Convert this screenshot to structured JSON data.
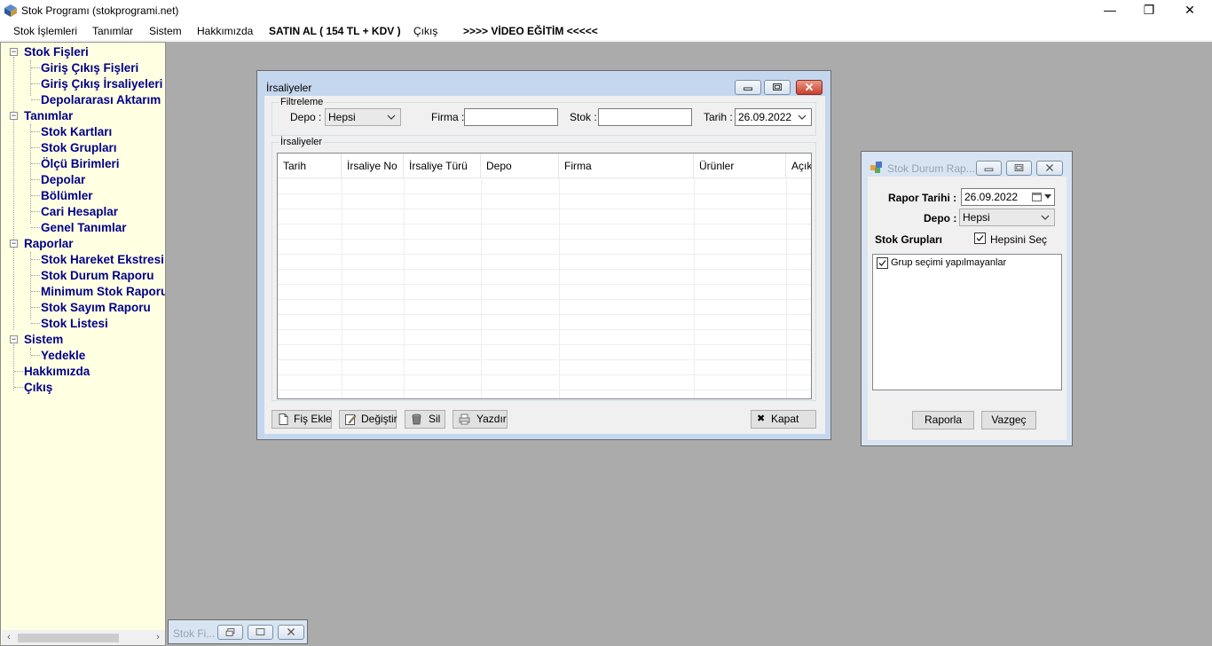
{
  "window": {
    "title": "Stok Programı (stokprogrami.net)",
    "minimize_glyph": "—",
    "restore_glyph": "❐",
    "close_glyph": "✕"
  },
  "menu": {
    "items": [
      {
        "label": "Stok İşlemleri"
      },
      {
        "label": "Tanımlar"
      },
      {
        "label": "Sistem"
      },
      {
        "label": "Hakkımızda"
      },
      {
        "label": "SATIN AL ( 154 TL + KDV )"
      },
      {
        "label": "Çıkış"
      },
      {
        "label": ">>>> VİDEO EĞİTİM <<<<<"
      }
    ]
  },
  "tree": {
    "nodes": [
      {
        "label": "Stok Fişleri",
        "level": 0,
        "expander": "−"
      },
      {
        "label": "Giriş Çıkış Fişleri",
        "level": 1
      },
      {
        "label": "Giriş Çıkış İrsaliyeleri",
        "level": 1
      },
      {
        "label": "Depolararası Aktarım",
        "level": 1
      },
      {
        "label": "Tanımlar",
        "level": 0,
        "expander": "−"
      },
      {
        "label": "Stok Kartları",
        "level": 1
      },
      {
        "label": "Stok Grupları",
        "level": 1
      },
      {
        "label": "Ölçü Birimleri",
        "level": 1
      },
      {
        "label": "Depolar",
        "level": 1
      },
      {
        "label": "Bölümler",
        "level": 1
      },
      {
        "label": "Cari Hesaplar",
        "level": 1
      },
      {
        "label": "Genel Tanımlar",
        "level": 1
      },
      {
        "label": "Raporlar",
        "level": 0,
        "expander": "−"
      },
      {
        "label": "Stok Hareket Ekstresi",
        "level": 1
      },
      {
        "label": "Stok Durum Raporu",
        "level": 1
      },
      {
        "label": "Minimum Stok Raporu",
        "level": 1
      },
      {
        "label": "Stok Sayım Raporu",
        "level": 1
      },
      {
        "label": "Stok Listesi",
        "level": 1
      },
      {
        "label": "Sistem",
        "level": 0,
        "expander": "−"
      },
      {
        "label": "Yedekle",
        "level": 1
      },
      {
        "label": "Hakkımızda",
        "level": 0
      },
      {
        "label": "Çıkış",
        "level": 0
      }
    ],
    "scroll_left": "‹",
    "scroll_right": "›"
  },
  "irsaliyeler": {
    "title": "İrsaliyeler",
    "filter_group": "Filtreleme",
    "depo_label": "Depo :",
    "depo_value": "Hepsi",
    "firma_label": "Firma :",
    "firma_value": "",
    "stok_label": "Stok :",
    "stok_value": "",
    "tarih_label": "Tarih :",
    "tarih_value": "26.09.2022",
    "list_group": "İrsaliyeler",
    "columns": [
      "Tarih",
      "İrsaliye No",
      "İrsaliye Türü",
      "Depo",
      "Firma",
      "Ürünler",
      "Açıkl"
    ],
    "buttons": {
      "fis_ekle": "Fiş Ekle",
      "degistir": "Değiştir",
      "sil": "Sil",
      "yazdir": "Yazdır",
      "kapat": "Kapat",
      "kapat_glyph": "✖"
    }
  },
  "stok_durum": {
    "title": "Stok Durum Rap...",
    "rapor_tarihi_label": "Rapor Tarihi :",
    "rapor_tarihi_value": "26.09.2022",
    "depo_label": "Depo :",
    "depo_value": "Hepsi",
    "stok_gruplari_label": "Stok Grupları",
    "hepsini_sec_label": "Hepsini Seç",
    "hepsini_sec_checked": true,
    "list_items": [
      {
        "label": "Grup seçimi yapılmayanlar",
        "checked": true
      }
    ],
    "raporla": "Raporla",
    "vazgec": "Vazgeç"
  },
  "minimized": {
    "title": "Stok Fi..."
  },
  "glyphs": {
    "check": "✓",
    "dropdown": "▾",
    "calendar": "▦"
  },
  "colors": {
    "tree_bg": "#ffffe1",
    "tree_text": "#00008b",
    "mdi_bg": "#ababab",
    "window_frame": "#c4d7ee"
  }
}
